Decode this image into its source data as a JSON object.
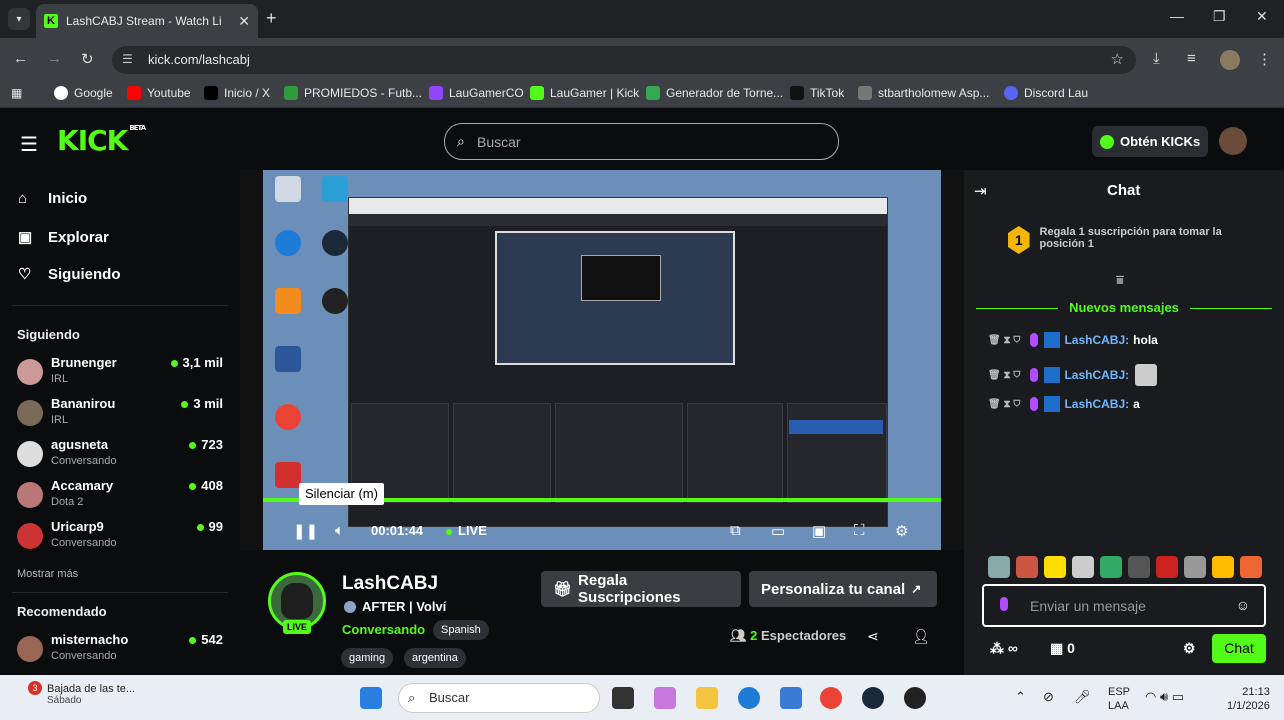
{
  "browser": {
    "tab_title": "LashCABJ Stream - Watch Li",
    "url": "kick.com/lashcabj",
    "bookmarks": [
      "Google",
      "Youtube",
      "Inicio / X",
      "PROMIEDOS - Futb...",
      "LauGamerCO",
      "LauGamer | Kick",
      "Generador de Torne...",
      "TikTok",
      "stbartholomew Asp...",
      "Discord Lau"
    ]
  },
  "kick": {
    "search_placeholder": "Buscar",
    "get_kicks": "Obtén KICKs",
    "nav": [
      "Inicio",
      "Explorar",
      "Siguiendo"
    ],
    "following_title": "Siguiendo",
    "following": [
      {
        "name": "Brunenger",
        "category": "IRL",
        "viewers": "3,1 mil"
      },
      {
        "name": "Bananirou",
        "category": "IRL",
        "viewers": "3 mil"
      },
      {
        "name": "agusneta",
        "category": "Conversando",
        "viewers": "723"
      },
      {
        "name": "Accamary",
        "category": "Dota 2",
        "viewers": "408"
      },
      {
        "name": "Uricarp9",
        "category": "Conversando",
        "viewers": "99"
      }
    ],
    "show_more": "Mostrar más",
    "recommended_title": "Recomendado",
    "recommended": [
      {
        "name": "misternacho",
        "category": "Conversando",
        "viewers": "542"
      }
    ]
  },
  "player": {
    "tooltip": "Silenciar (m)",
    "time": "00:01:44",
    "live": "LIVE",
    "progress_fraction": 1.0
  },
  "channel": {
    "name": "LashCABJ",
    "title": "AFTER | Volví",
    "category": "Conversando",
    "tags": [
      "Spanish",
      "gaming",
      "argentina"
    ],
    "live_badge": "LIVE",
    "gift_button": "Regala Suscripciones",
    "customize_button": "Personaliza tu canal",
    "viewers_count": "2",
    "viewers_label": "Espectadores"
  },
  "chat": {
    "title": "Chat",
    "gift_prompt": "Regala 1 suscripción para tomar la posición 1",
    "gift_rank": "1",
    "new_messages": "Nuevos mensajes",
    "messages": [
      {
        "user": "LashCABJ:",
        "text": "hola"
      },
      {
        "user": "LashCABJ:",
        "text": ""
      },
      {
        "user": "LashCABJ:",
        "text": "a"
      }
    ],
    "input_placeholder": "Enviar un mensaje",
    "points": "∞",
    "gifts": "0",
    "send": "Chat"
  },
  "taskbar": {
    "news_badge": "3",
    "news_title": "Bajada de las te...",
    "news_sub": "Sábado",
    "search_placeholder": "Buscar",
    "lang1": "ESP",
    "lang2": "LAA",
    "time": "21:13",
    "date": "1/1/2026"
  },
  "colors": {
    "kick_green": "#53fc18",
    "bg": "#0b0c0e",
    "chat_bg": "#191b1f"
  }
}
